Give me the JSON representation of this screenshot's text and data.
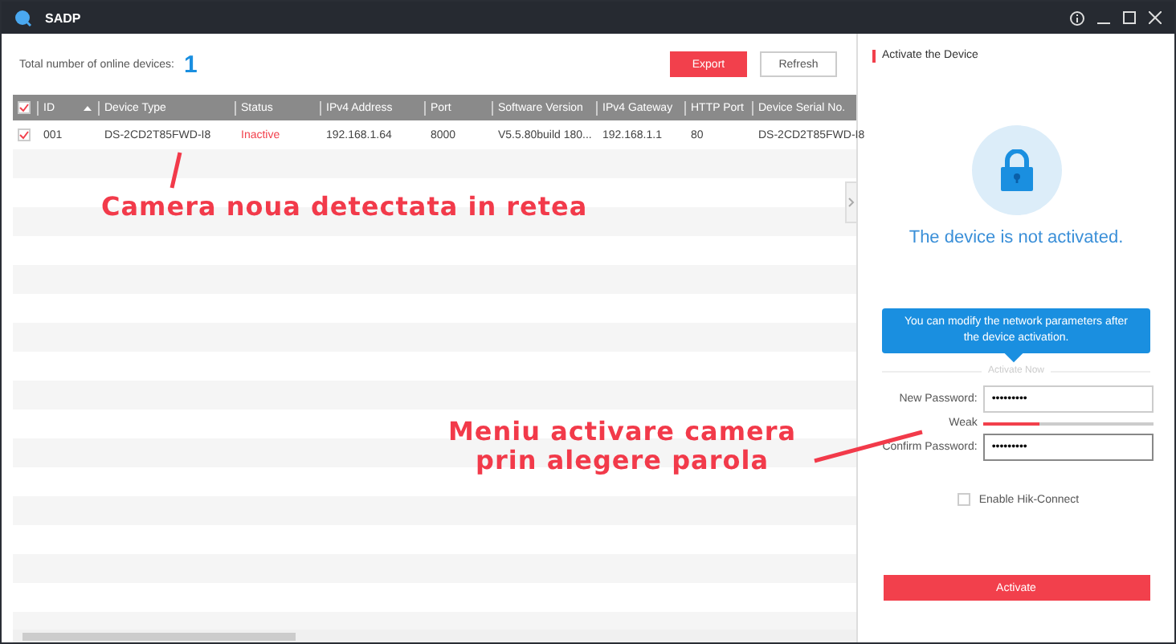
{
  "window": {
    "title": "SADP"
  },
  "summary": {
    "label": "Total number of online devices:",
    "count": "1"
  },
  "buttons": [
    {
      "label": "Export",
      "kind": "primary"
    },
    {
      "label": "Refresh",
      "kind": "secondary"
    }
  ],
  "table": {
    "select_all": {
      "checked": true
    },
    "columns": [
      {
        "label": "ID",
        "sorted": true
      },
      {
        "label": "Device Type",
        "sorted": false
      },
      {
        "label": "Status",
        "sorted": false
      },
      {
        "label": "IPv4 Address",
        "sorted": false
      },
      {
        "label": "Port",
        "sorted": false
      },
      {
        "label": "Software Version",
        "sorted": false
      },
      {
        "label": "IPv4 Gateway",
        "sorted": false
      },
      {
        "label": "HTTP Port",
        "sorted": false
      },
      {
        "label": "Device Serial No.",
        "sorted": false
      }
    ],
    "rows": [
      {
        "checked": true,
        "cells": [
          "001",
          "DS-2CD2T85FWD-I8",
          "Inactive",
          "192.168.1.64",
          "8000",
          "V5.5.80build 180...",
          "192.168.1.1",
          "80",
          "DS-2CD2T85FWD-I8"
        ]
      }
    ]
  },
  "annotations": [
    {
      "text": "Camera noua detectata in retea"
    },
    {
      "text": "Meniu activare camera\nprin alegere parola"
    }
  ],
  "panel": {
    "title": "Activate the Device",
    "status": "The device is not activated.",
    "tip": "You can modify the network parameters after the device activation.",
    "section": "Activate Now",
    "fields": [
      {
        "label": "New Password:",
        "value": "•••••••••"
      },
      {
        "label": "Confirm Password:",
        "value": "•••••••••"
      }
    ],
    "strength": {
      "label": "Weak",
      "level": 0.33
    },
    "hik_connect": {
      "label": "Enable Hik-Connect",
      "checked": false
    },
    "activate": "Activate"
  }
}
